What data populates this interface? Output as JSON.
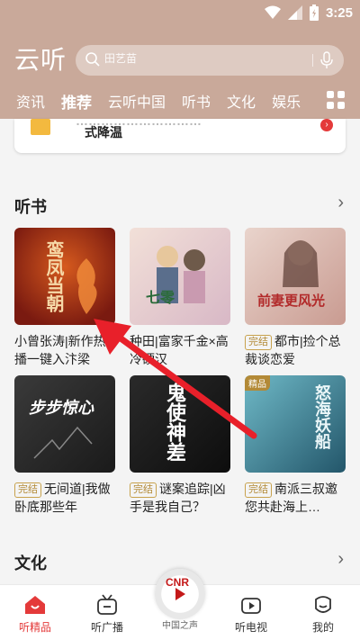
{
  "status": {
    "time": "3:25"
  },
  "header": {
    "logo": "云听",
    "search_placeholder": "田艺苗"
  },
  "tabs": [
    "资讯",
    "推荐",
    "云听中国",
    "听书",
    "文化",
    "娱乐"
  ],
  "active_tab_index": 1,
  "banner": {
    "line1": "…………………………",
    "line2": "式降温"
  },
  "sections": {
    "tingshu": {
      "title": "听书",
      "more": "›"
    },
    "wenhua": {
      "title": "文化",
      "more": "›"
    }
  },
  "books": [
    {
      "badge": "",
      "title": "小曾张涛|新作热播一键入汴梁",
      "cover_text": "鸾凤当朝"
    },
    {
      "badge": "",
      "title": "种田|富家千金×高冷硬汉",
      "cover_text": "七零"
    },
    {
      "badge": "完结",
      "title": "都市|捡个总裁谈恋爱",
      "cover_text": "前妻更风光"
    },
    {
      "badge": "",
      "title": "无间道|我做卧底那些年",
      "cover_text": "步步惊心",
      "badge2": "完结"
    },
    {
      "badge": "完结",
      "title": "谜案追踪|凶手是我自己？",
      "cover_text": "鬼使神差"
    },
    {
      "badge": "完结",
      "title": "南派三叔邀您共赴海上…",
      "cover_text": "怒海妖船",
      "tag": "精品"
    }
  ],
  "bottom_nav": [
    {
      "label": "听精品"
    },
    {
      "label": "听广播"
    },
    {
      "label": "中国之声"
    },
    {
      "label": "听电视"
    },
    {
      "label": "我的"
    }
  ],
  "cnr_logo": "CNR",
  "colors": {
    "header_bg": "#c9a99a",
    "accent_red": "#e43a3a",
    "badge_gold": "#b38a37"
  }
}
